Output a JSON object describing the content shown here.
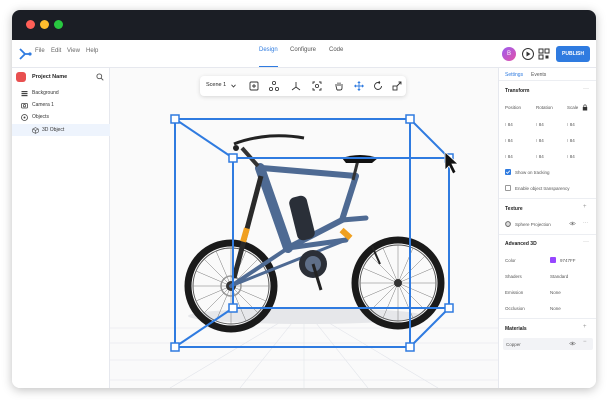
{
  "menu": [
    "File",
    "Edit",
    "View",
    "Help"
  ],
  "modes": [
    "Design",
    "Configure",
    "Code"
  ],
  "active_mode": "Design",
  "user": {
    "initial": "B"
  },
  "publish_label": "PUBLISH",
  "project": {
    "name": "Project Name"
  },
  "layers": [
    "Background",
    "Camera 1",
    "Objects",
    "3D Object"
  ],
  "viewport": {
    "scene": "Scene 1"
  },
  "panel": {
    "tabs": [
      "Settings",
      "Events"
    ],
    "transform": {
      "title": "Transform",
      "headers": [
        "Position",
        "Rotation",
        "Scale"
      ],
      "rows": [
        [
          "84",
          "84",
          "84"
        ],
        [
          "84",
          "84",
          "84"
        ],
        [
          "84",
          "84",
          "84"
        ]
      ]
    },
    "checks": [
      "Show on tracking",
      "Enable object transparency"
    ],
    "texture": {
      "title": "Texture",
      "item": "Sphere Projection"
    },
    "advanced": {
      "title": "Advanced 3D",
      "color_label": "Color",
      "color_value": "9747FF",
      "shaders_label": "Shaders",
      "shaders_value": "Standard",
      "emission_label": "Emission",
      "emission_value": "None",
      "occlusion_label": "Occlusion",
      "occlusion_value": "None"
    },
    "materials": {
      "title": "Materials",
      "item": "Copper"
    }
  },
  "colors": {
    "accent": "#2f7be0",
    "titlebar": "#1b1e25",
    "swatch": "#9747FF"
  }
}
